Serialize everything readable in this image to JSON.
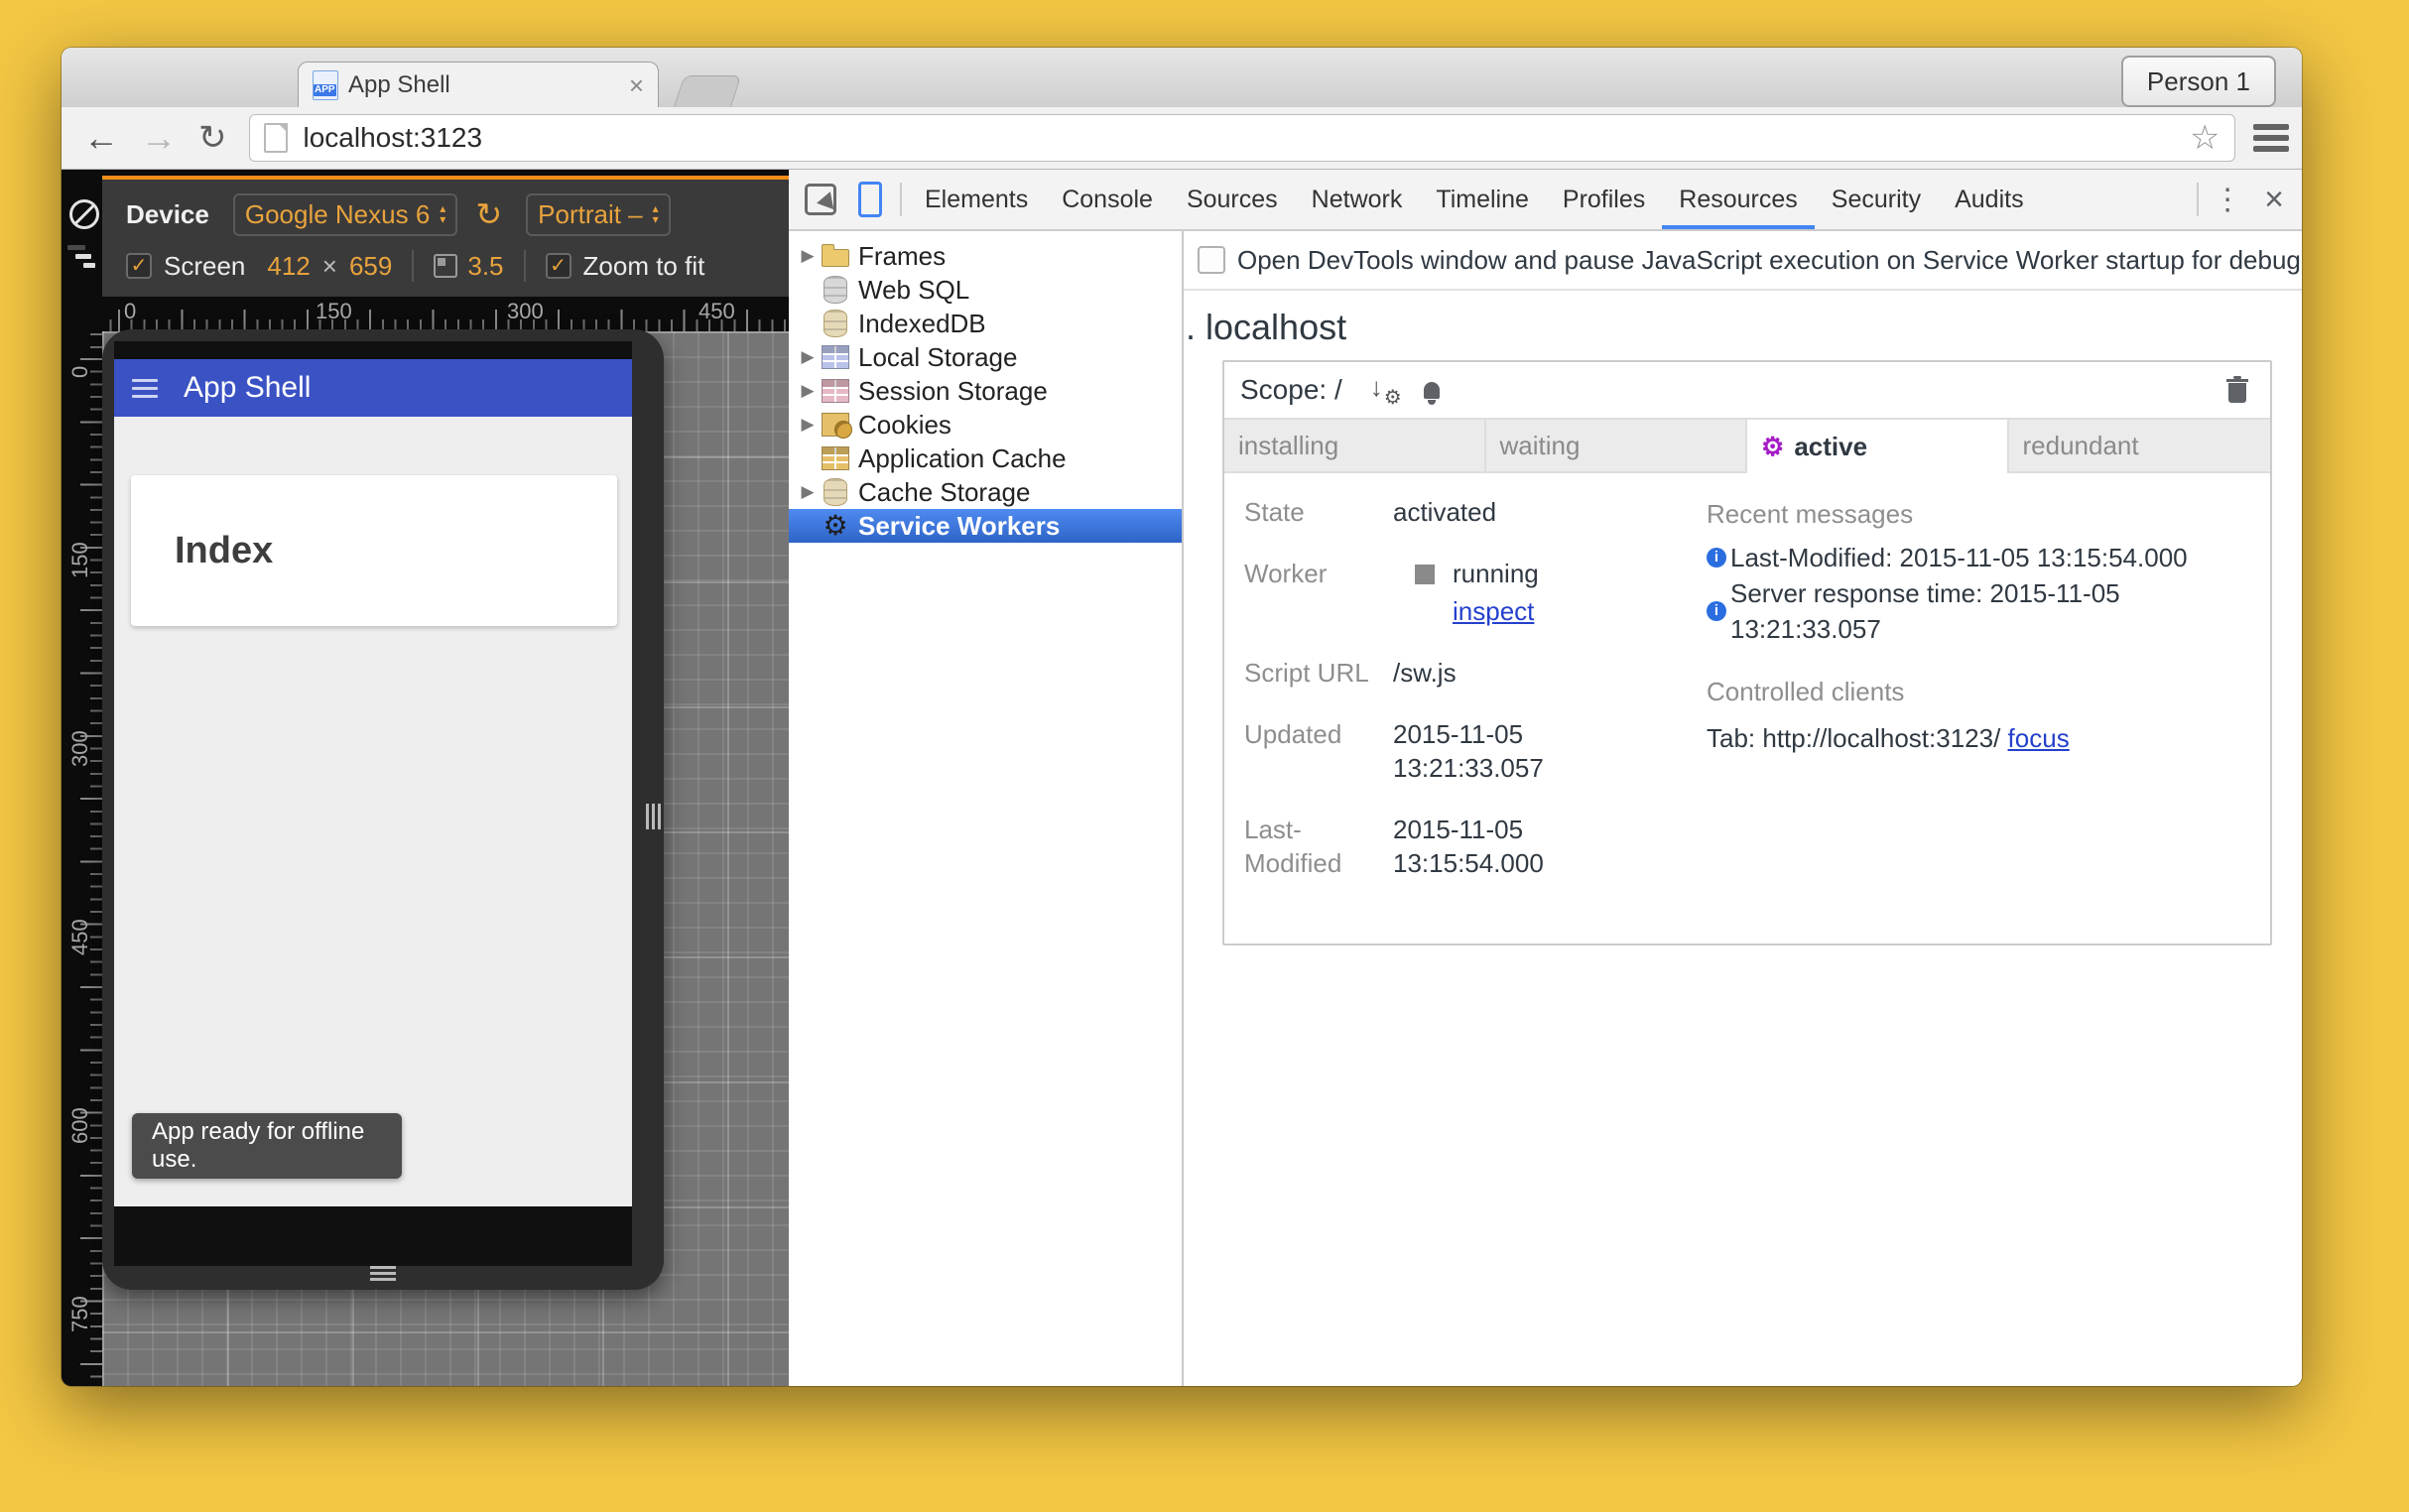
{
  "colors": {
    "desktop_yellow": "#F3C643",
    "accent_orange": "#E8A33D",
    "devtools_tab_blue": "#4285F4",
    "app_header_blue": "#3B52C4",
    "tree_selection_blue": "#2E63C7",
    "lifecycle_active_purple": "#A41CC6",
    "link_blue": "#2440CC"
  },
  "titlebar": {
    "tab_title": "App Shell",
    "tab_close": "×",
    "favicon_label": "APP",
    "profile_button": "Person 1"
  },
  "toolbar": {
    "back_icon": "←",
    "forward_icon": "→",
    "reload_icon": "↻",
    "url": "localhost:3123",
    "star_icon": "☆"
  },
  "device_toolbar": {
    "device_label": "Device",
    "device_model": "Google Nexus 6",
    "reload_icon": "↻",
    "orientation": "Portrait –",
    "check": "✓",
    "screen_checkbox": "Screen",
    "screen_width": "412",
    "times": "×",
    "screen_height": "659",
    "dpr": "3.5",
    "zoom_checkbox": "Zoom to fit",
    "arrow_up": "▴",
    "arrow_down": "▾"
  },
  "rulers": {
    "horizontal": [
      "0",
      "150",
      "300",
      "450"
    ],
    "vertical": [
      "0",
      "150",
      "300",
      "450",
      "600",
      "750"
    ]
  },
  "app": {
    "header_title": "App Shell",
    "card_title": "Index",
    "toast": "App ready for offline use."
  },
  "devtools": {
    "tabs": [
      "Elements",
      "Console",
      "Sources",
      "Network",
      "Timeline",
      "Profiles",
      "Resources",
      "Security",
      "Audits"
    ],
    "selected_tab": "Resources",
    "more_icon": "⋮",
    "close_icon": "×",
    "sidebar": [
      {
        "label": "Frames",
        "icon": "folder-icon",
        "expandable": true
      },
      {
        "label": "Web SQL",
        "icon": "database-gray-icon",
        "expandable": false
      },
      {
        "label": "IndexedDB",
        "icon": "database-tan-icon",
        "expandable": false
      },
      {
        "label": "Local Storage",
        "icon": "table-blue-icon",
        "expandable": true
      },
      {
        "label": "Session Storage",
        "icon": "table-pink-icon",
        "expandable": true
      },
      {
        "label": "Cookies",
        "icon": "cookie-icon",
        "expandable": true
      },
      {
        "label": "Application Cache",
        "icon": "table-gold-icon",
        "expandable": false
      },
      {
        "label": "Cache Storage",
        "icon": "database-tan-icon",
        "expandable": true
      },
      {
        "label": "Service Workers",
        "icon": "gear-icon",
        "expandable": false,
        "selected": true
      }
    ],
    "expander_glyph": "▶",
    "panel": {
      "pause_label": "Open DevTools window and pause JavaScript execution on Service Worker startup for debugg",
      "origin_heading": ". localhost",
      "scope_label": "Scope: /",
      "lifecycle": [
        "installing",
        "waiting",
        "active",
        "redundant"
      ],
      "lifecycle_active": "active",
      "gear_glyph": "⚙",
      "details": {
        "state_label": "State",
        "state_value": "activated",
        "worker_label": "Worker",
        "worker_status": "running",
        "inspect_link": "inspect",
        "script_label": "Script URL",
        "script_value": "/sw.js",
        "updated_label": "Updated",
        "updated_date": "2015-11-05",
        "updated_time": "13:21:33.057",
        "modified_label": "Last-Modified",
        "modified_date": "2015-11-05",
        "modified_time": "13:15:54.000"
      },
      "recent": {
        "title": "Recent messages",
        "info_glyph": "i",
        "messages": [
          "Last-Modified: 2015-11-05 13:15:54.000",
          "Server response time: 2015-11-05 13:21:33.057"
        ]
      },
      "clients": {
        "title": "Controlled clients",
        "tab_text": "Tab: http://localhost:3123/",
        "focus_link": "focus"
      }
    }
  }
}
